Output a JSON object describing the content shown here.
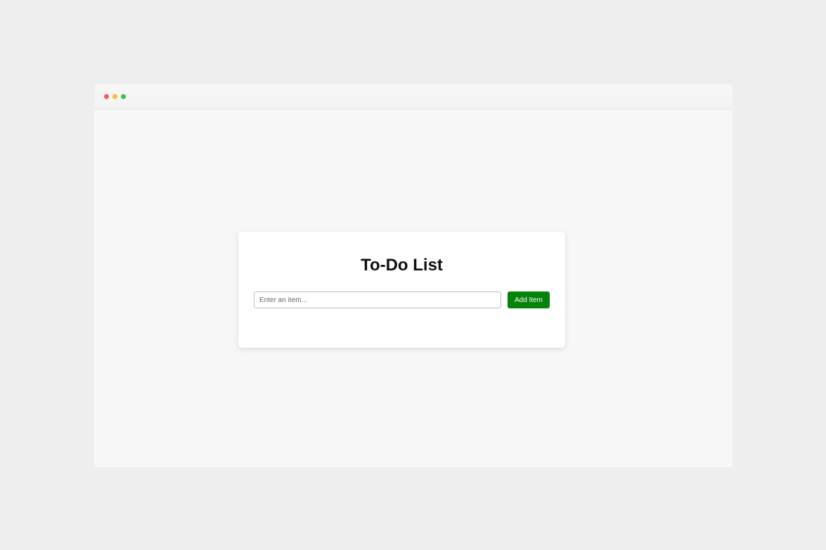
{
  "window": {
    "controls": [
      "close",
      "minimize",
      "zoom"
    ]
  },
  "todo": {
    "title": "To-Do List",
    "input_placeholder": "Enter an item...",
    "input_value": "",
    "add_button_label": "Add Item",
    "items": []
  },
  "colors": {
    "accent": "#058208",
    "page_background": "#eeeeee",
    "window_background": "#f7f7f7",
    "card_background": "#ffffff"
  }
}
